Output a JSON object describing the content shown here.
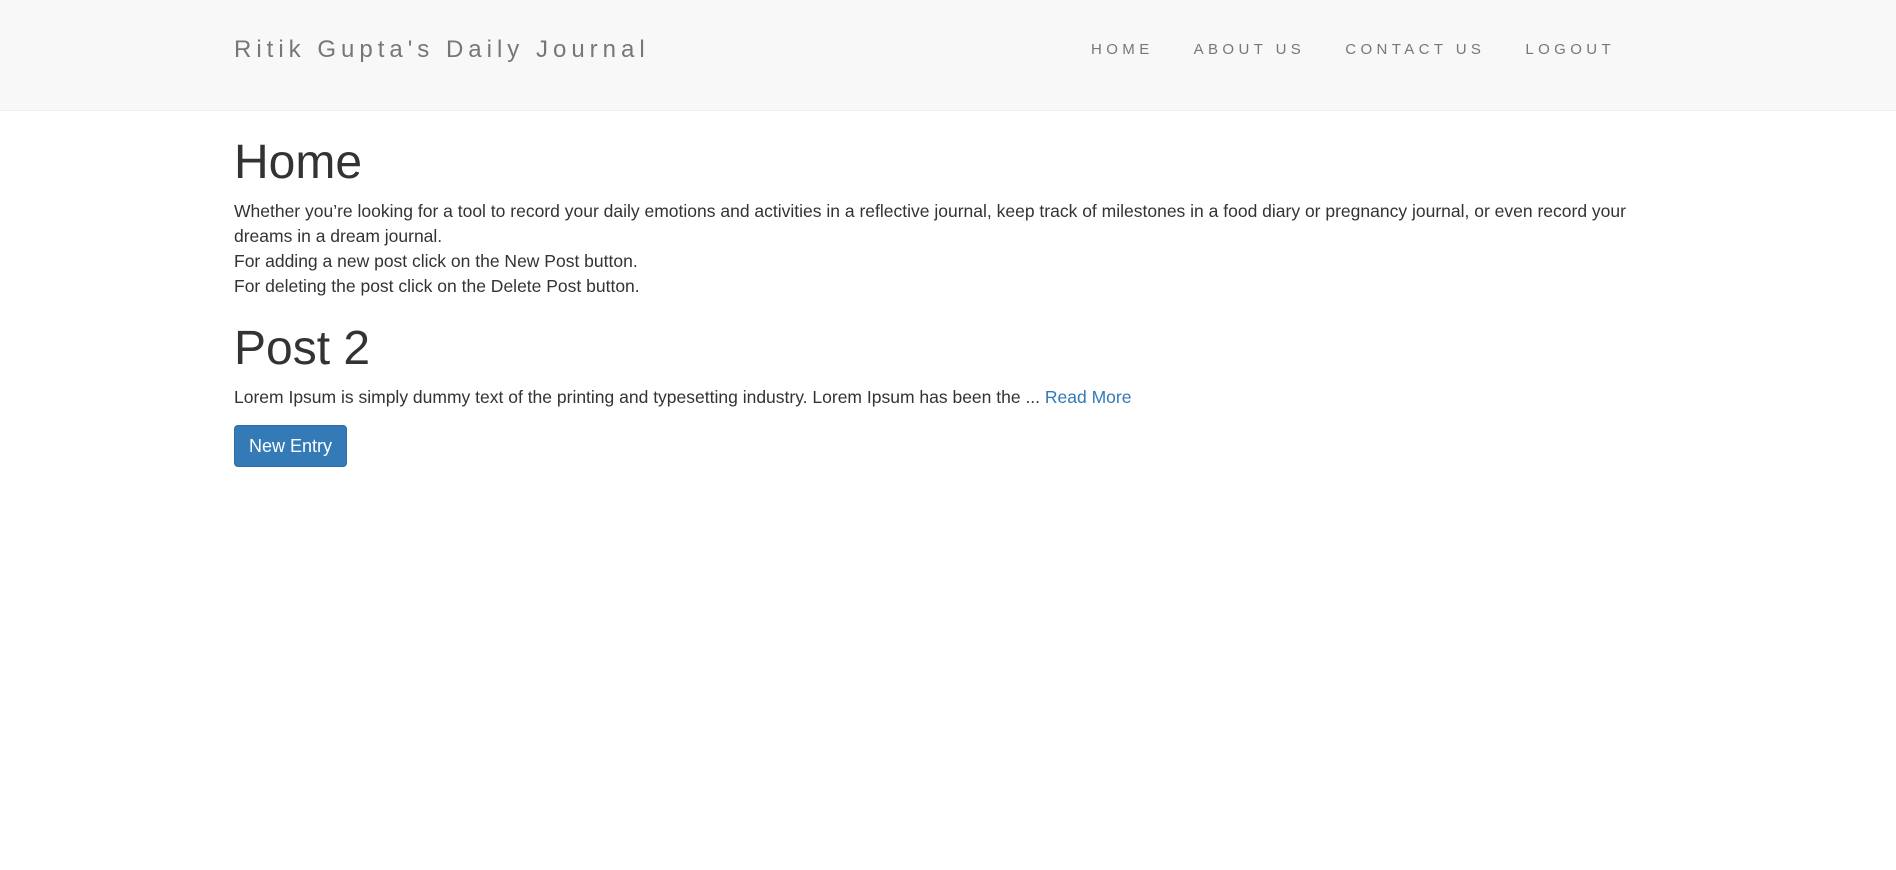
{
  "navbar": {
    "brand": "Ritik Gupta's Daily Journal",
    "links": [
      "HOME",
      "ABOUT US",
      "CONTACT US",
      "LOGOUT"
    ]
  },
  "home": {
    "title": "Home",
    "paragraphs": [
      "Whether you’re looking for a tool to record your daily emotions and activities in a reflective journal, keep track of milestones in a food diary or pregnancy journal, or even record your dreams in a dream journal.",
      "For adding a new post click on the New Post button.",
      "For deleting the post click on the Delete Post button."
    ]
  },
  "posts": [
    {
      "title": "Post 2",
      "excerpt": "Lorem Ipsum is simply dummy text of the printing and typesetting industry. Lorem Ipsum has been the ... ",
      "read_more": "Read More"
    }
  ],
  "actions": {
    "new_entry_label": "New Entry"
  },
  "colors": {
    "navbar_bg": "#f8f8f8",
    "nav_text": "#777777",
    "body_text": "#333333",
    "link": "#337ab7",
    "primary_button": "#337ab7"
  }
}
